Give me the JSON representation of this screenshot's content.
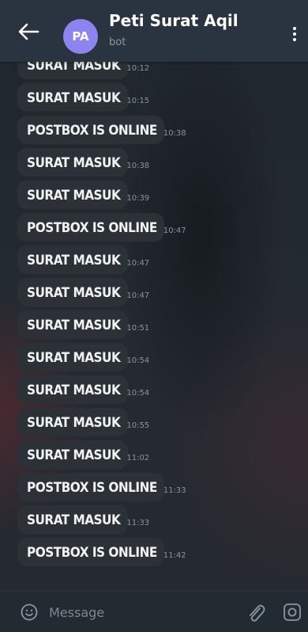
{
  "header": {
    "title": "Peti Surat Aqil",
    "subtitle": "bot",
    "avatar_initials": "PA",
    "avatar_color": "#8e84f0"
  },
  "messages": [
    {
      "text": "SURAT MASUK",
      "time": "10:12"
    },
    {
      "text": "SURAT MASUK",
      "time": "10:15"
    },
    {
      "text": "POSTBOX IS ONLINE",
      "time": "10:38"
    },
    {
      "text": "SURAT MASUK",
      "time": "10:38"
    },
    {
      "text": "SURAT MASUK",
      "time": "10:39"
    },
    {
      "text": "POSTBOX IS ONLINE",
      "time": "10:47"
    },
    {
      "text": "SURAT MASUK",
      "time": "10:47"
    },
    {
      "text": "SURAT MASUK",
      "time": "10:47"
    },
    {
      "text": "SURAT MASUK",
      "time": "10:51"
    },
    {
      "text": "SURAT MASUK",
      "time": "10:54"
    },
    {
      "text": "SURAT MASUK",
      "time": "10:54"
    },
    {
      "text": "SURAT MASUK",
      "time": "10:55"
    },
    {
      "text": "SURAT MASUK",
      "time": "11:02"
    },
    {
      "text": "POSTBOX IS ONLINE",
      "time": "11:33"
    },
    {
      "text": "SURAT MASUK",
      "time": "11:33"
    },
    {
      "text": "POSTBOX IS ONLINE",
      "time": "11:42"
    }
  ],
  "input": {
    "placeholder": "Message"
  },
  "icons": {
    "back": "back-arrow-icon",
    "menu": "more-vertical-icon",
    "emoji": "emoji-icon",
    "attach": "paperclip-icon",
    "camera": "camera-icon"
  }
}
